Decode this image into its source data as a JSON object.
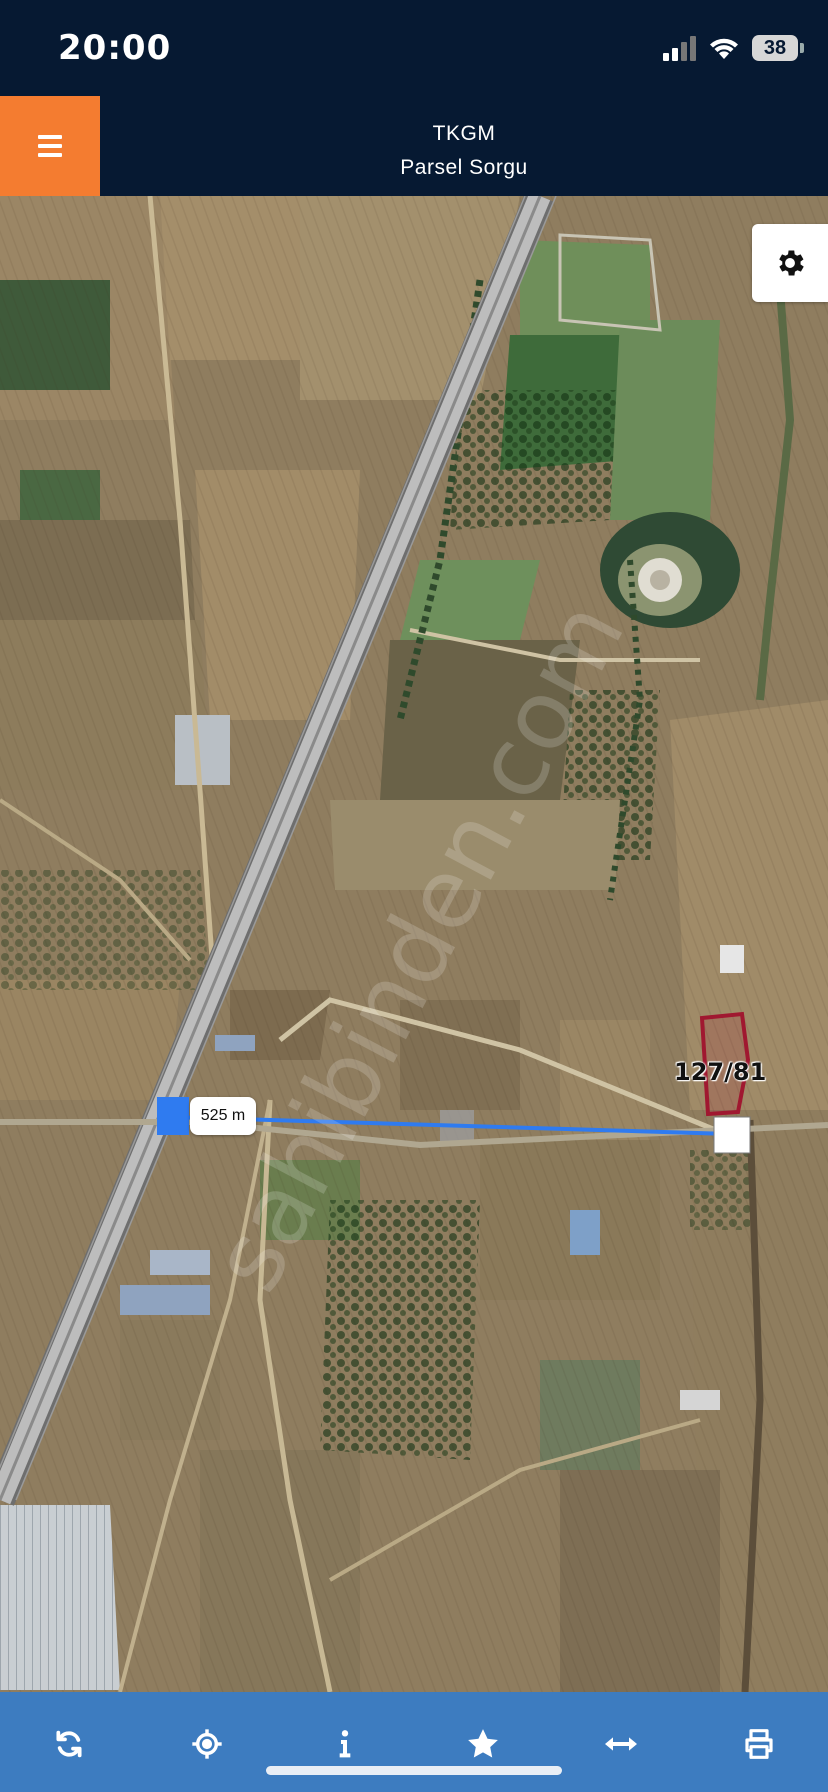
{
  "status_bar": {
    "time": "20:00",
    "battery": "38",
    "icons": [
      "signal-icon",
      "wifi-icon",
      "battery-icon"
    ]
  },
  "header": {
    "menu_icon": "hamburger-menu-icon",
    "title": "TKGM",
    "subtitle": "Parsel Sorgu"
  },
  "map": {
    "settings_icon": "gear-icon",
    "distance_label": "525 m",
    "parcel_label": "127/81",
    "watermark": "sahibinden.com"
  },
  "toolbar": {
    "items": [
      {
        "icon": "refresh-icon"
      },
      {
        "icon": "locate-icon"
      },
      {
        "icon": "info-icon"
      },
      {
        "icon": "star-icon"
      },
      {
        "icon": "measure-icon"
      },
      {
        "icon": "print-icon"
      }
    ]
  },
  "colors": {
    "header_bg": "#061932",
    "menu_accent": "#f47c30",
    "toolbar_bg": "#3d7cc0",
    "measure_line": "#2f7bf0",
    "parcel_outline": "#a01830"
  }
}
